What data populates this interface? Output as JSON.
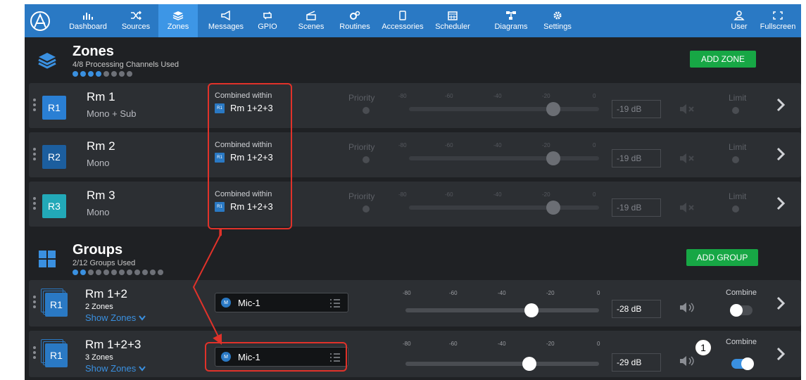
{
  "nav": {
    "items": [
      {
        "label": "Dashboard",
        "icon": "dashboard-icon"
      },
      {
        "label": "Sources",
        "icon": "shuffle-icon"
      },
      {
        "label": "Zones",
        "icon": "layers-icon",
        "active": true
      },
      {
        "label": "Messages",
        "icon": "megaphone-icon"
      },
      {
        "label": "GPIO",
        "icon": "gpio-icon"
      },
      {
        "label": "Scenes",
        "icon": "clapper-icon"
      },
      {
        "label": "Routines",
        "icon": "gears-icon"
      },
      {
        "label": "Accessories",
        "icon": "phone-icon"
      },
      {
        "label": "Scheduler",
        "icon": "calendar-icon"
      },
      {
        "label": "Diagrams",
        "icon": "diagram-icon"
      },
      {
        "label": "Settings",
        "icon": "gear-icon"
      }
    ],
    "right": [
      {
        "label": "User",
        "icon": "user-icon"
      },
      {
        "label": "Fullscreen",
        "icon": "fullscreen-icon"
      }
    ]
  },
  "zones": {
    "title": "Zones",
    "subtitle": "4/8 Processing Channels Used",
    "used": 4,
    "total": 8,
    "add_label": "ADD ZONE",
    "rows": [
      {
        "badge": "R1",
        "name": "Rm 1",
        "sub": "Mono + Sub",
        "combined_label": "Combined within",
        "combined_badge": "R1",
        "combined_value": "Rm 1+2+3",
        "priority": "Priority",
        "db": "-19 dB",
        "limit": "Limit",
        "level": 0.76,
        "color": "#2a7fd4"
      },
      {
        "badge": "R2",
        "name": "Rm 2",
        "sub": "Mono",
        "combined_label": "Combined within",
        "combined_badge": "R1",
        "combined_value": "Rm 1+2+3",
        "priority": "Priority",
        "db": "-19 dB",
        "limit": "Limit",
        "level": 0.76,
        "color": "#1c5e9e"
      },
      {
        "badge": "R3",
        "name": "Rm 3",
        "sub": "Mono",
        "combined_label": "Combined within",
        "combined_badge": "R1",
        "combined_value": "Rm 1+2+3",
        "priority": "Priority",
        "db": "-19 dB",
        "limit": "Limit",
        "level": 0.76,
        "color": "#22a9b8"
      }
    ]
  },
  "groups": {
    "title": "Groups",
    "subtitle": "2/12 Groups Used",
    "used": 2,
    "total": 12,
    "add_label": "ADD GROUP",
    "rows": [
      {
        "badge": "R1",
        "name": "Rm 1+2",
        "sub": "2 Zones",
        "show": "Show Zones",
        "source_badge": "M",
        "source": "Mic-1",
        "db": "-28 dB",
        "combine": "Combine",
        "combine_on": false,
        "level": 0.65
      },
      {
        "badge": "R1",
        "name": "Rm 1+2+3",
        "sub": "3 Zones",
        "show": "Show Zones",
        "source_badge": "M",
        "source": "Mic-1",
        "db": "-29 dB",
        "combine": "Combine",
        "combine_on": true,
        "level": 0.64
      }
    ]
  },
  "ticks": [
    "-80",
    "-60",
    "-40",
    "-20",
    "0"
  ],
  "callout": "1",
  "colors": {
    "nav": "#2a79c4",
    "active": "#3d96e6",
    "add": "#17a745",
    "annotation": "#e0322a",
    "row": "#2c2f33",
    "bg": "#1f2124"
  }
}
